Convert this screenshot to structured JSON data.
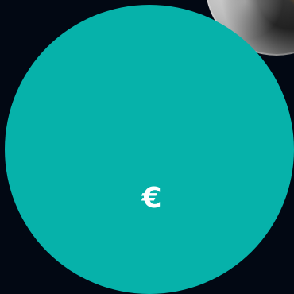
{
  "symbol": "€",
  "colors": {
    "background": "#020813",
    "circle": "#06b2aa",
    "symbol": "#ffffff"
  }
}
